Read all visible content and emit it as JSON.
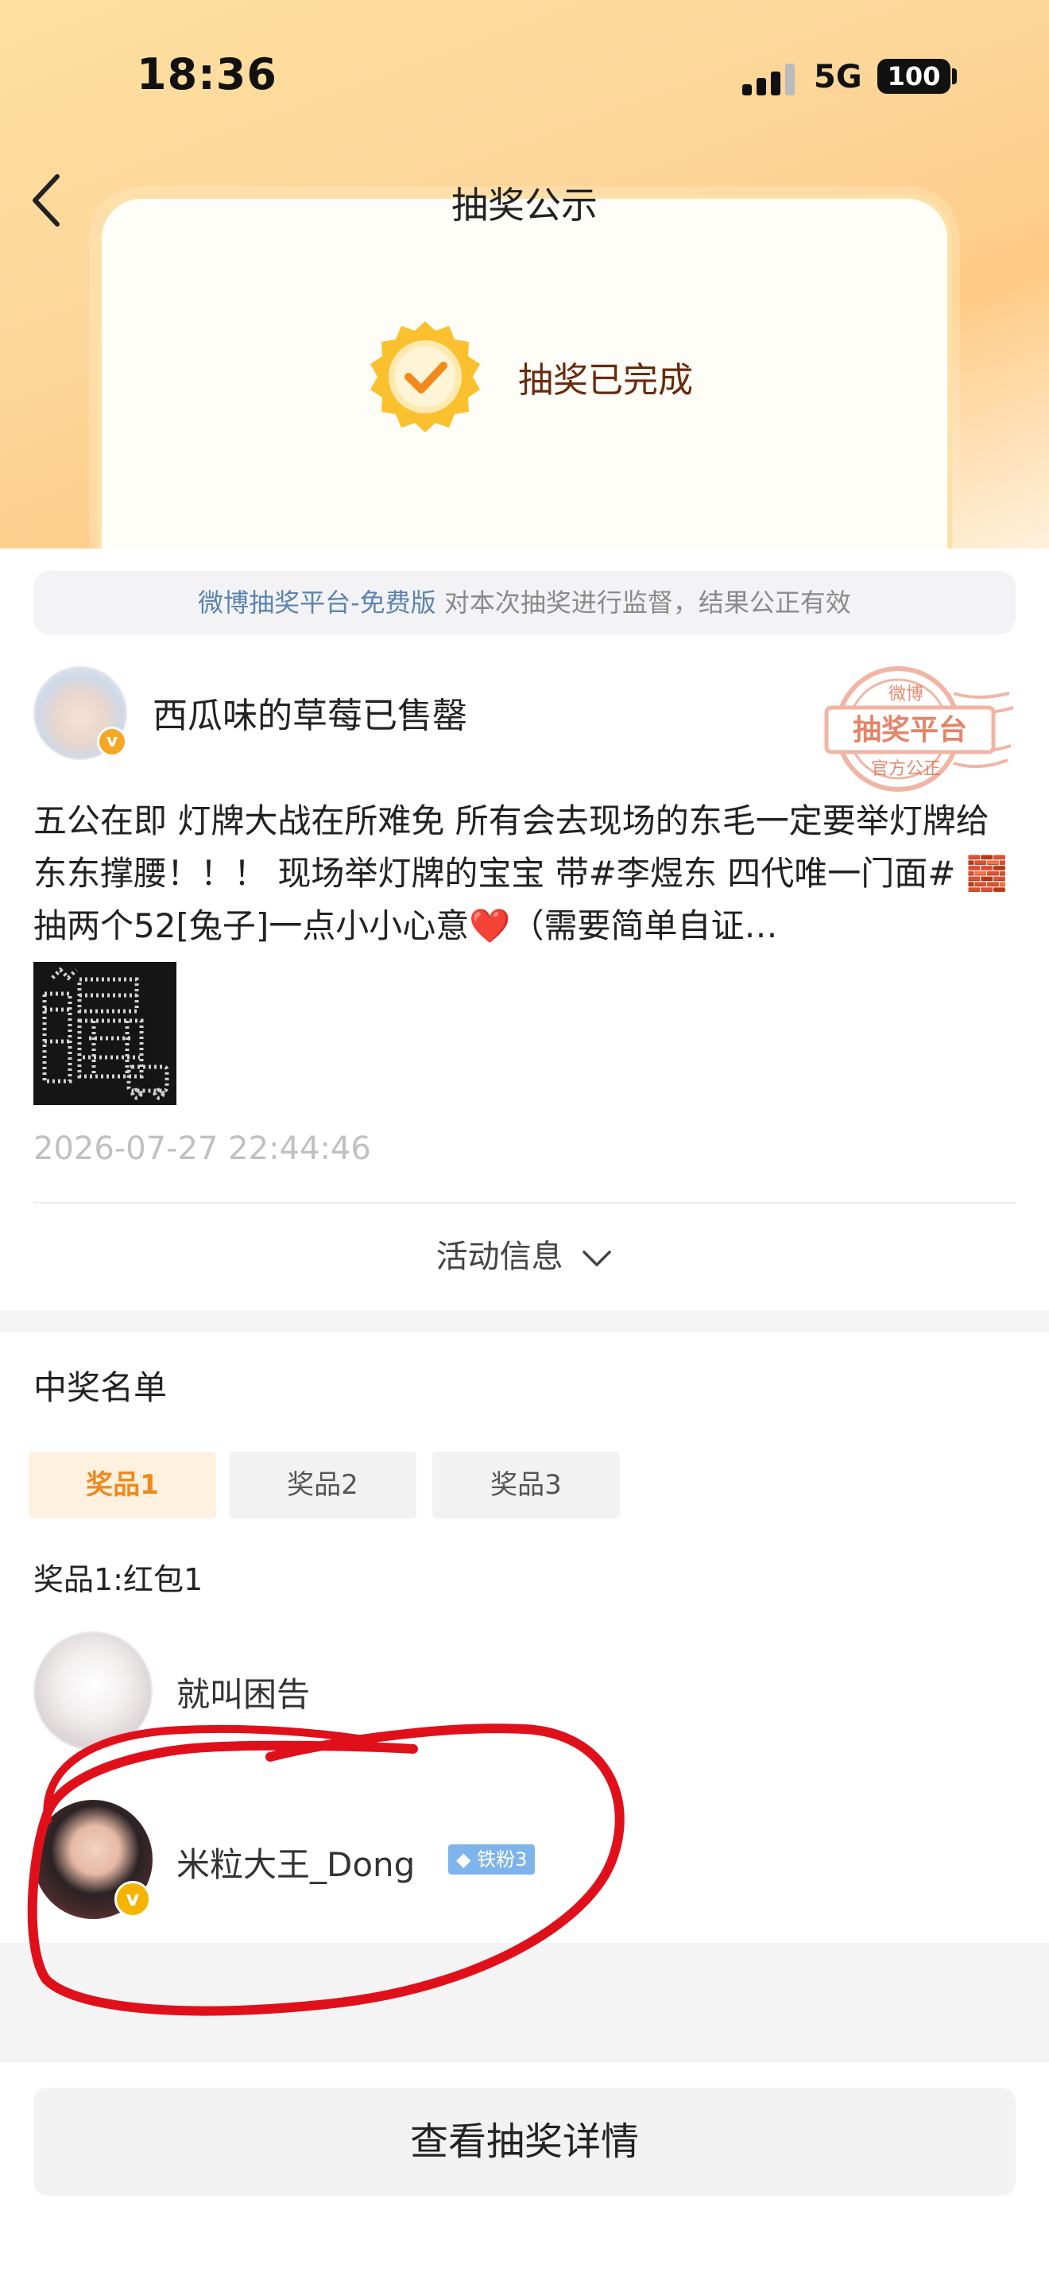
{
  "status_bar": {
    "time": "18:36",
    "network": "5G",
    "battery": "100"
  },
  "header": {
    "title": "抽奖公示"
  },
  "result_card": {
    "status_text": "抽奖已完成"
  },
  "notice": {
    "platform_link": "微博抽奖平台-免费版",
    "text": " 对本次抽奖进行监督，结果公正有效"
  },
  "post": {
    "author_name": "西瓜味的草莓已售罄",
    "stamp_top": "微博",
    "stamp_main": "抽奖平台",
    "stamp_bottom": "官方公正",
    "text": "五公在即 灯牌大战在所难免 所有会去现场的东毛一定要举灯牌给东东撑腰！！！ 现场举灯牌的宝宝 带#李煜东 四代唯一门面# 🧱 抽两个52[兔子]一点小小心意❤️（需要简单自证…",
    "time": "2026-07-27 22:44:46"
  },
  "activity": {
    "label": "活动信息"
  },
  "winners": {
    "title": "中奖名单",
    "tabs": [
      {
        "label": "奖品1"
      },
      {
        "label": "奖品2"
      },
      {
        "label": "奖品3"
      }
    ],
    "prize_desc": "奖品1:红包1",
    "list": [
      {
        "name": "就叫困告"
      },
      {
        "name": "米粒大王_Dong",
        "fan_badge": "铁粉3"
      }
    ]
  },
  "footer": {
    "detail_button": "查看抽奖详情"
  },
  "colors": {
    "accent": "#ee8a1e",
    "link": "#5c84b0",
    "annotation": "#e0101a"
  }
}
